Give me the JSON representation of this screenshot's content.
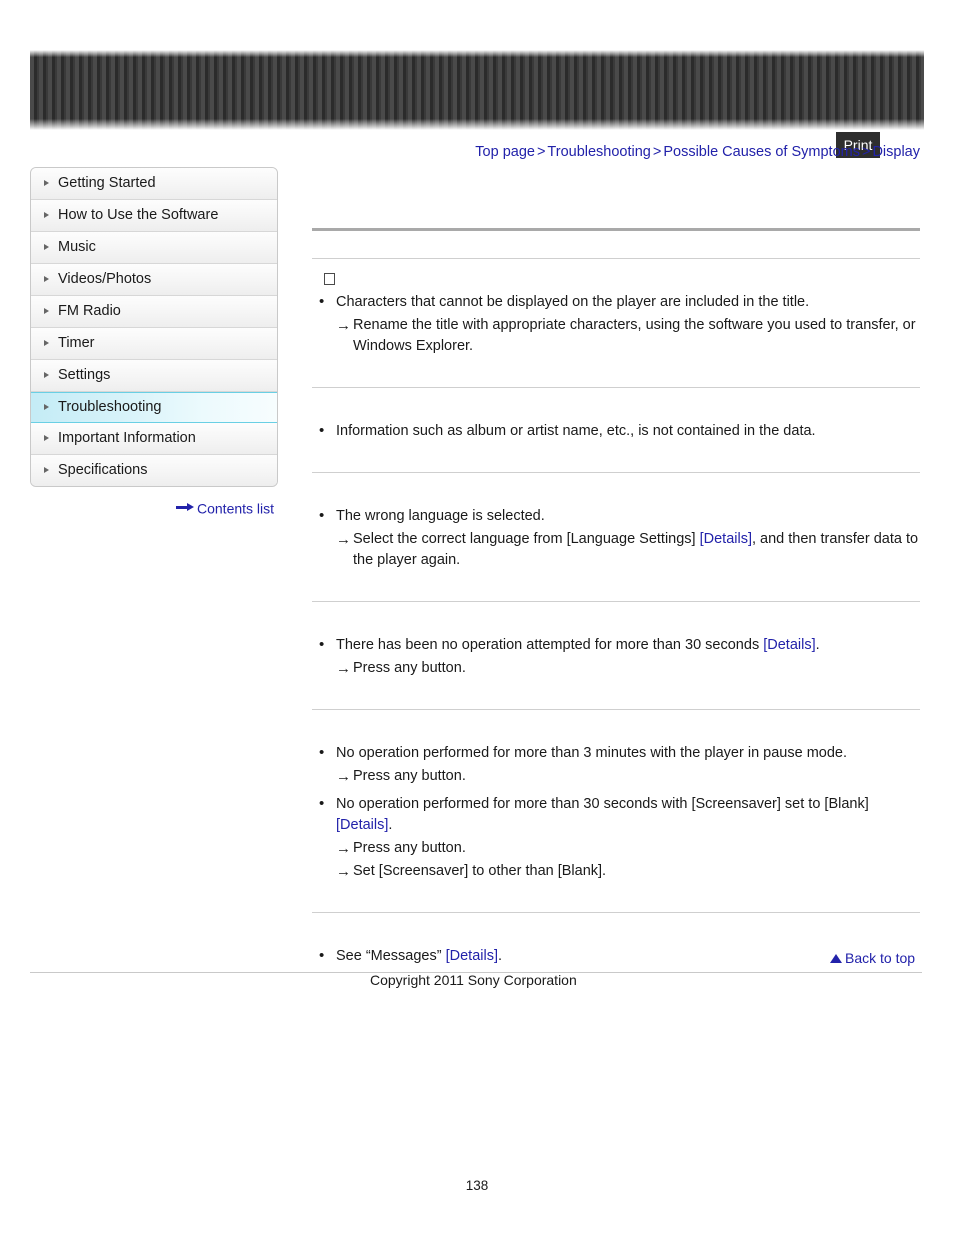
{
  "header": {
    "print_label": "Print"
  },
  "breadcrumb": {
    "separator": ">",
    "items": [
      {
        "label": "Top page"
      },
      {
        "label": "Troubleshooting"
      },
      {
        "label": "Possible Causes of Symptoms"
      },
      {
        "label": "Display"
      }
    ]
  },
  "sidebar": {
    "items": [
      {
        "label": "Getting Started",
        "active": false
      },
      {
        "label": "How to Use the Software",
        "active": false
      },
      {
        "label": "Music",
        "active": false
      },
      {
        "label": "Videos/Photos",
        "active": false
      },
      {
        "label": "FM Radio",
        "active": false
      },
      {
        "label": "Timer",
        "active": false
      },
      {
        "label": "Settings",
        "active": false
      },
      {
        "label": "Troubleshooting",
        "active": true
      },
      {
        "label": "Important Information",
        "active": false
      },
      {
        "label": "Specifications",
        "active": false
      }
    ],
    "contents_list_label": "Contents list"
  },
  "content": {
    "tofu_glyph": "□",
    "sections": [
      {
        "bullets": [
          {
            "text_before": "Characters that cannot be displayed on the player are included in the title.",
            "link": "",
            "text_after": "",
            "subitems": [
              {
                "text_before": "Rename the title with appropriate characters, using the software you used to transfer, or Windows Explorer.",
                "link": "",
                "text_after": ""
              }
            ]
          }
        ]
      },
      {
        "bullets": [
          {
            "text_before": "Information such as album or artist name, etc., is not contained in the data.",
            "link": "",
            "text_after": "",
            "subitems": []
          }
        ]
      },
      {
        "bullets": [
          {
            "text_before": "The wrong language is selected.",
            "link": "",
            "text_after": "",
            "subitems": [
              {
                "text_before": "Select the correct language from [Language Settings] ",
                "link": "[Details]",
                "text_after": ", and then transfer data to the player again."
              }
            ]
          }
        ]
      },
      {
        "bullets": [
          {
            "text_before": "There has been no operation attempted for more than 30 seconds ",
            "link": "[Details]",
            "text_after": ".",
            "subitems": [
              {
                "text_before": "Press any button.",
                "link": "",
                "text_after": ""
              }
            ]
          }
        ]
      },
      {
        "bullets": [
          {
            "text_before": "No operation performed for more than 3 minutes with the player in pause mode.",
            "link": "",
            "text_after": "",
            "subitems": [
              {
                "text_before": "Press any button.",
                "link": "",
                "text_after": ""
              }
            ]
          },
          {
            "text_before": "No operation performed for more than 30 seconds with [Screensaver] set to [Blank] ",
            "link": "[Details]",
            "text_after": ".",
            "subitems": [
              {
                "text_before": "Press any button.",
                "link": "",
                "text_after": ""
              },
              {
                "text_before": "Set [Screensaver] to other than [Blank].",
                "link": "",
                "text_after": ""
              }
            ]
          }
        ]
      },
      {
        "bullets": [
          {
            "text_before": "See “Messages” ",
            "link": "[Details]",
            "text_after": ".",
            "subitems": []
          }
        ]
      }
    ]
  },
  "footer": {
    "back_to_top_label": "Back to top",
    "copyright": "Copyright 2011 Sony Corporation",
    "page_number": "138"
  },
  "colors": {
    "link": "#2222aa",
    "active_nav": "#c4ecf6",
    "rule": "#cfcfcf",
    "banner": "#2b2b2b"
  }
}
